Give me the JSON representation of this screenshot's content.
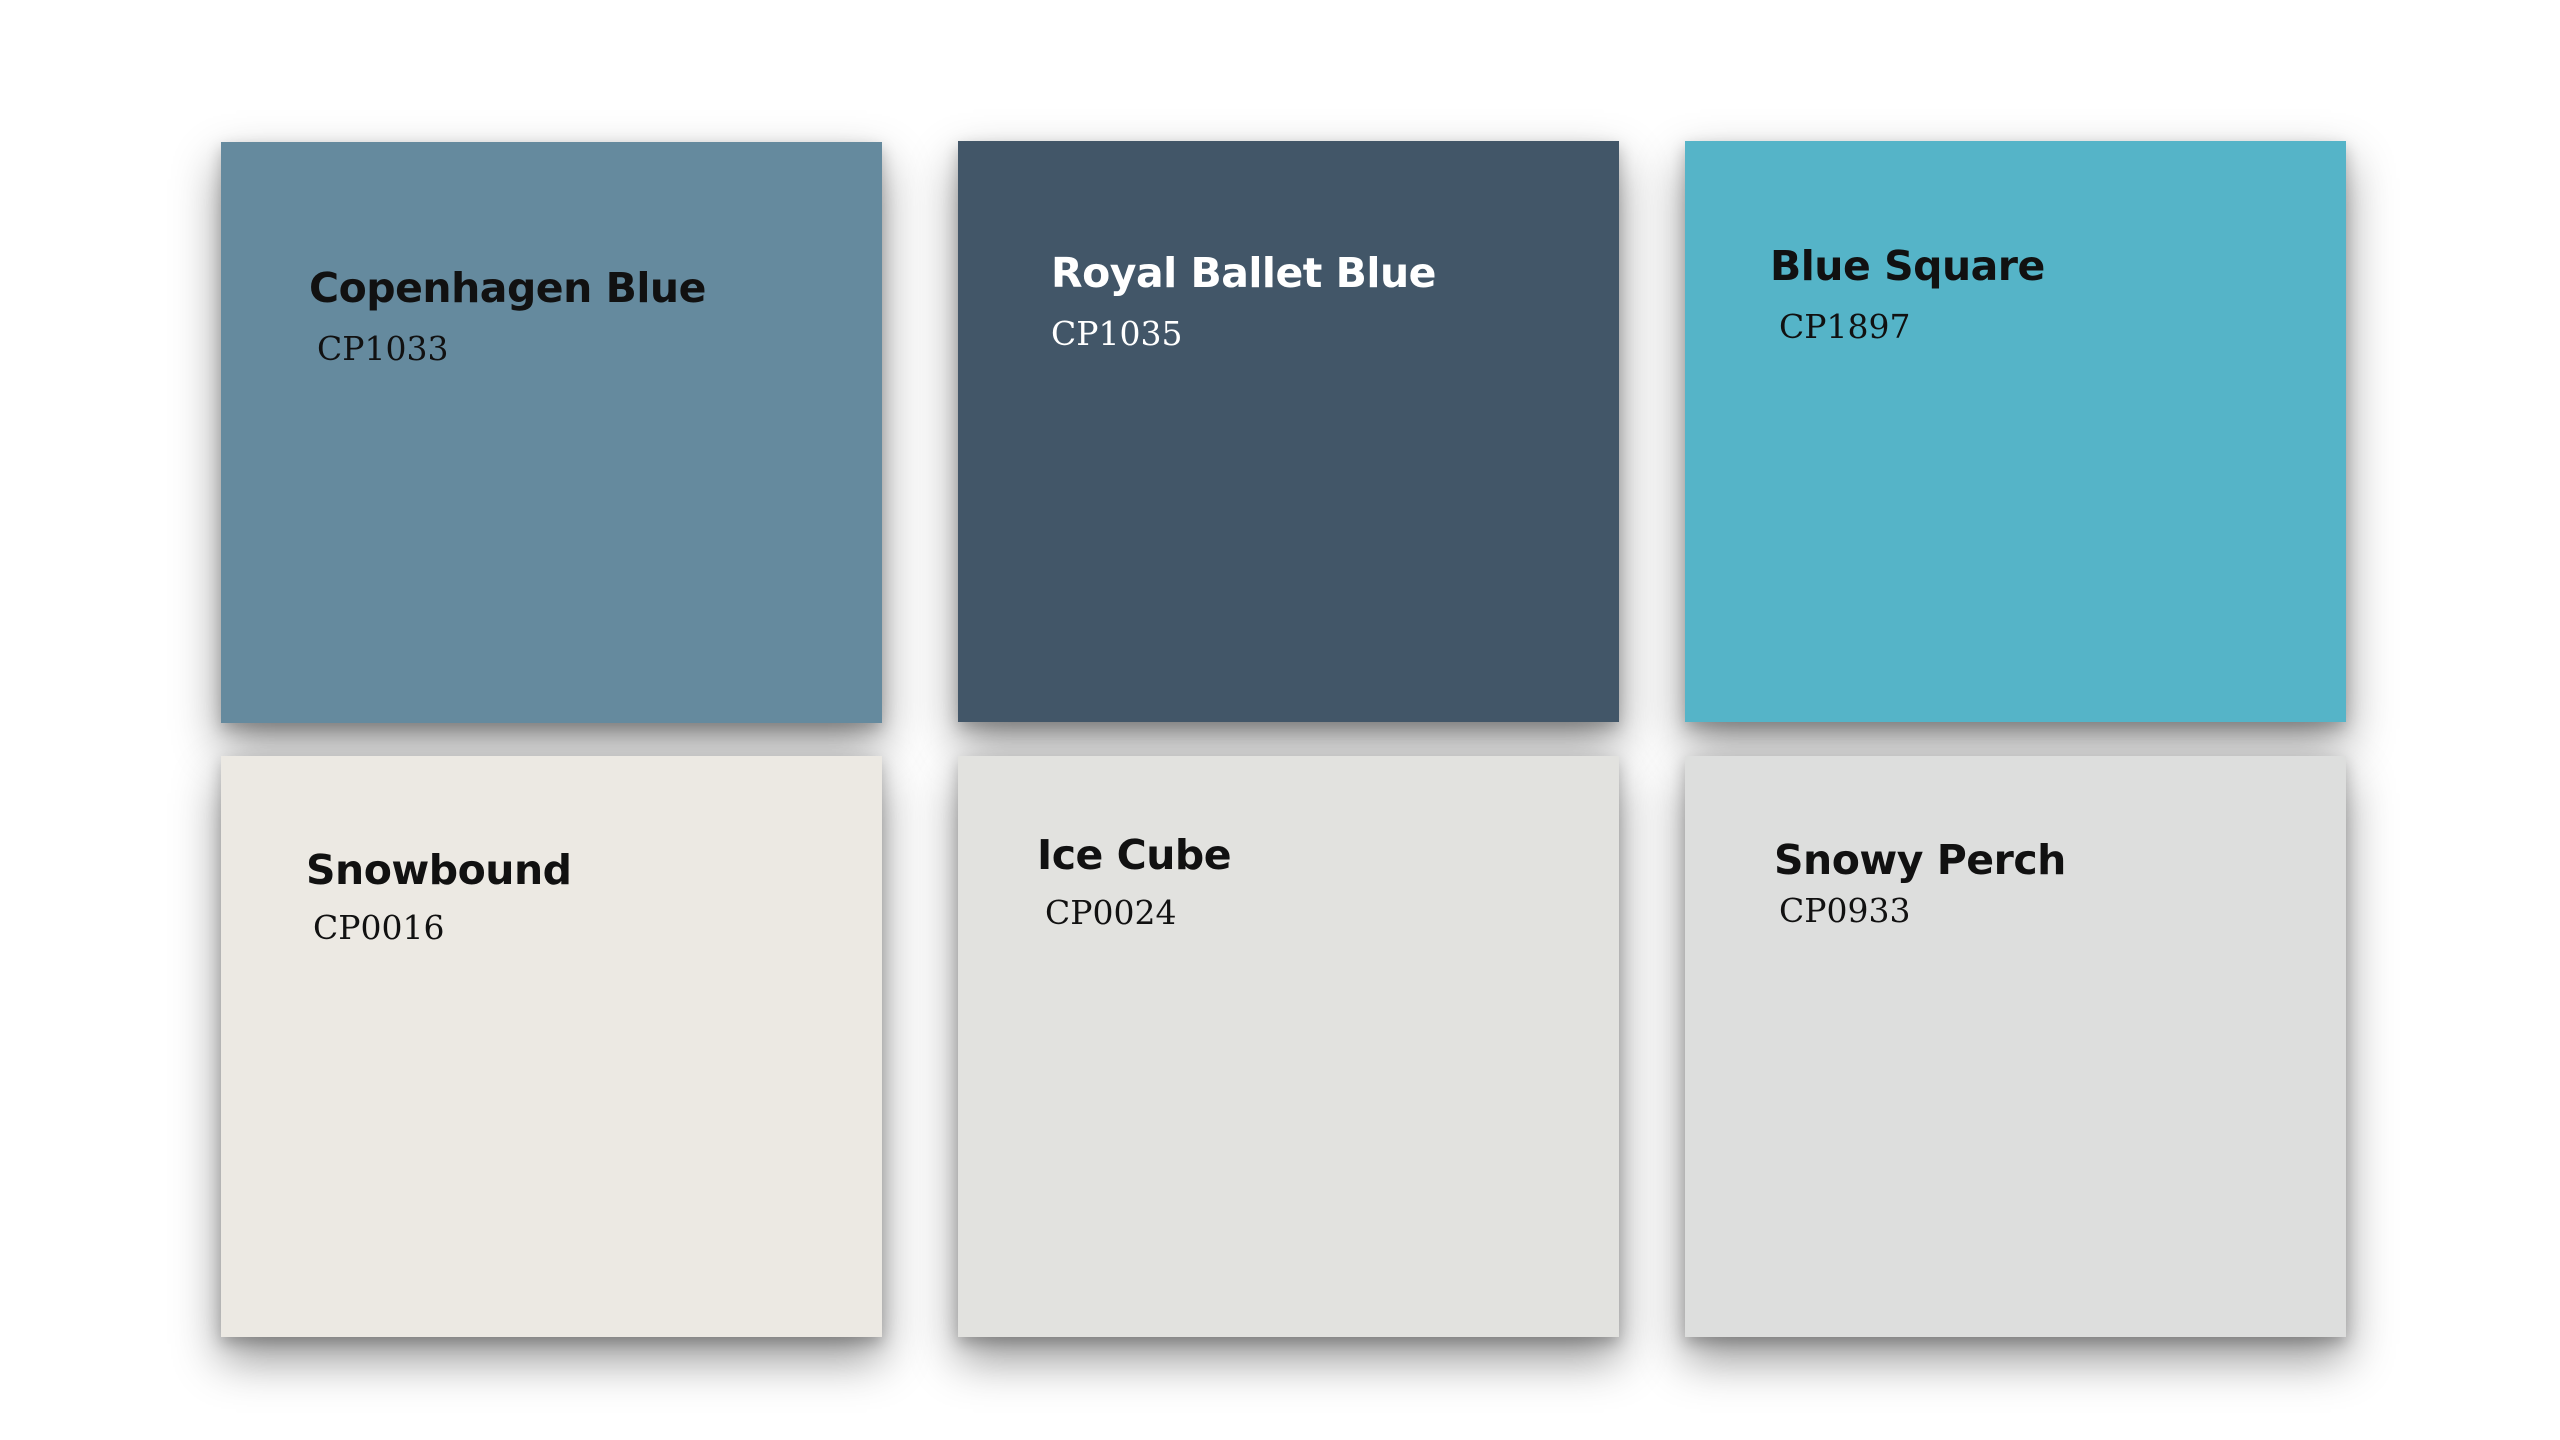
{
  "swatches": [
    {
      "name": "Copenhagen Blue",
      "code": "CP1033",
      "color": "#658a9e",
      "text_color": "#111111"
    },
    {
      "name": "Royal Ballet Blue",
      "code": "CP1035",
      "color": "#425668",
      "text_color": "#ffffff"
    },
    {
      "name": "Blue Square",
      "code": "CP1897",
      "color": "#55b4c8",
      "text_color": "#111111"
    },
    {
      "name": "Snowbound",
      "code": "CP0016",
      "color": "#ece9e3",
      "text_color": "#111111"
    },
    {
      "name": "Ice Cube",
      "code": "CP0024",
      "color": "#e2e2df",
      "text_color": "#111111"
    },
    {
      "name": "Snowy Perch",
      "code": "CP0933",
      "color": "#dddedd",
      "text_color": "#111111"
    }
  ]
}
